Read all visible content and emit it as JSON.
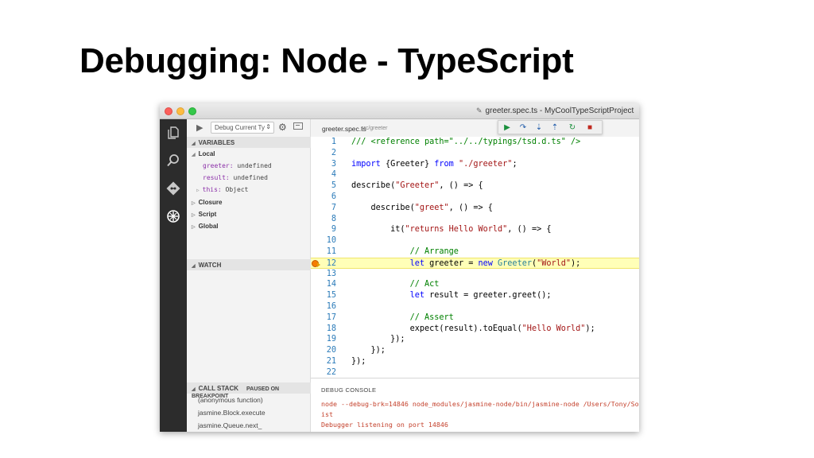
{
  "slide_title": "Debugging: Node - TypeScript",
  "window": {
    "title": "greeter.spec.ts - MyCoolTypeScriptProject"
  },
  "sidebar": {
    "config_select": "Debug Current Ty",
    "sections": {
      "variables": "VARIABLES",
      "watch": "WATCH",
      "call_stack": "CALL STACK",
      "call_stack_status": "PAUSED ON BREAKPOINT"
    },
    "scopes": {
      "local": "Local",
      "closure": "Closure",
      "script": "Script",
      "global": "Global"
    },
    "variables": [
      {
        "name": "greeter:",
        "value": "undefined"
      },
      {
        "name": "result:",
        "value": "undefined"
      },
      {
        "name": "this:",
        "value": "Object"
      }
    ],
    "call_stack": [
      "(anonymous function)",
      "jasmine.Block.execute",
      "jasmine.Queue.next_"
    ]
  },
  "editor": {
    "tab_name": "greeter.spec.ts",
    "tab_path": "src/greeter",
    "current_line": 12,
    "breakpoint_line": 12
  },
  "debug_console": {
    "title": "DEBUG CONSOLE",
    "lines": [
      "node --debug-brk=14846 node_modules/jasmine-node/bin/jasmine-node /Users/Tony/Sou",
      "ist",
      "Debugger listening on port 14846"
    ]
  },
  "colors": {
    "activity_bar": "#2c2c2c",
    "current_line": "#ffffb8",
    "breakpoint": "#f57c00",
    "line_numbers": "#2b7bb9",
    "console_text": "#c4412c"
  }
}
